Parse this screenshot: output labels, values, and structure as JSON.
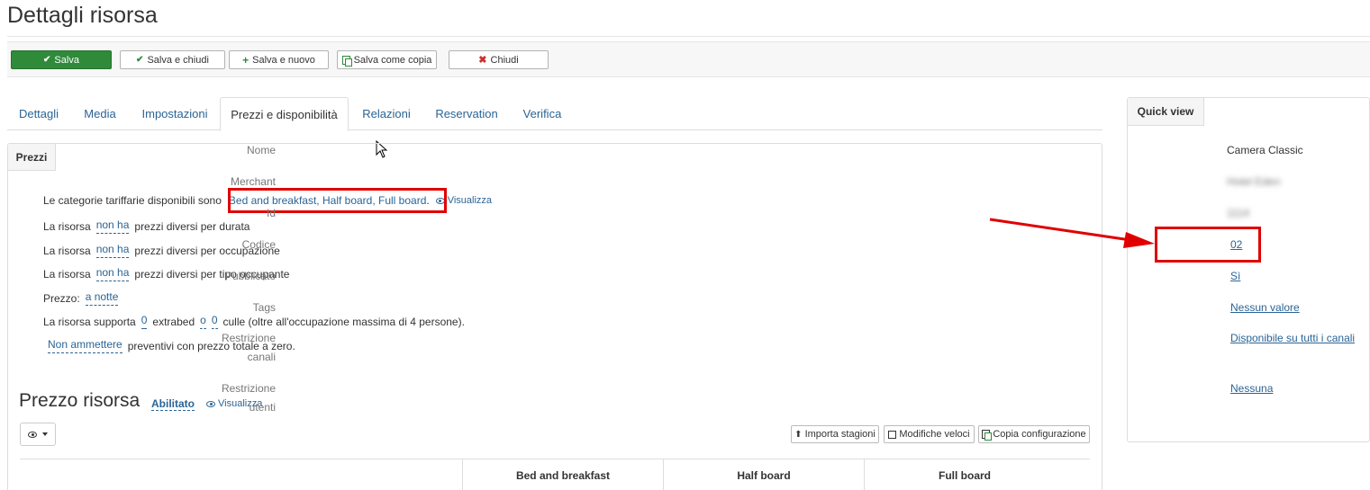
{
  "page": {
    "title": "Dettagli risorsa"
  },
  "toolbar": {
    "save": "Salva",
    "save_close": "Salva e chiudi",
    "save_new": "Salva e nuovo",
    "save_copy": "Salva come copia",
    "close": "Chiudi"
  },
  "tabs": [
    "Dettagli",
    "Media",
    "Impostazioni",
    "Prezzi e disponibilità",
    "Relazioni",
    "Reservation",
    "Verifica"
  ],
  "prices": {
    "panel_tab": "Prezzi",
    "categories_intro": "Le categorie tariffarie disponibili sono",
    "categories": "Bed and breakfast, Half board, Full board",
    "categories_suffix": ".",
    "view": "Visualizza",
    "resource": "La risorsa",
    "non_ha": "non ha",
    "by_duration": "prezzi diversi per durata",
    "by_occupancy": "prezzi diversi per occupazione",
    "by_occupant_type": "prezzi diversi per tipo occupante",
    "price_label": "Prezzo:",
    "per_night": "a notte",
    "supports": "La risorsa supporta",
    "extrabed_count": "0",
    "extrabed": "extrabed",
    "or": "o",
    "cribs_count": "0",
    "cribs_text": "culle (oltre all'occupazione massima di 4 persone).",
    "not_allow": "Non ammettere",
    "zero_quotes": "preventivi con prezzo totale a zero."
  },
  "resource_price": {
    "title": "Prezzo risorsa",
    "status": "Abilitato",
    "view": "Visualizza",
    "import_seasons": "Importa stagioni",
    "quick_edits": "Modifiche veloci",
    "copy_config": "Copia configurazione",
    "columns": [
      "Bed and breakfast",
      "Half board",
      "Full board"
    ]
  },
  "quick_view": {
    "title": "Quick view",
    "name_label": "Nome",
    "name": "Camera Classic",
    "merchant_label": "Merchant",
    "merchant": "Hotel Eden",
    "id_label": "Id",
    "id": "1114",
    "code_label": "Codice",
    "code": "02",
    "published_label": "Pubblicato",
    "published": "Sì",
    "tags_label": "Tags",
    "tags": "Nessun valore",
    "channels_label_1": "Restrizione",
    "channels_label_2": "canali",
    "channels": "Disponibile su tutti i canali",
    "users_label_1": "Restrizione",
    "users_label_2": "utenti",
    "users": "Nessuna"
  },
  "colors": {
    "primary_green": "#2f8a3a",
    "link_blue": "#2a6496",
    "highlight_red": "#e00000"
  }
}
